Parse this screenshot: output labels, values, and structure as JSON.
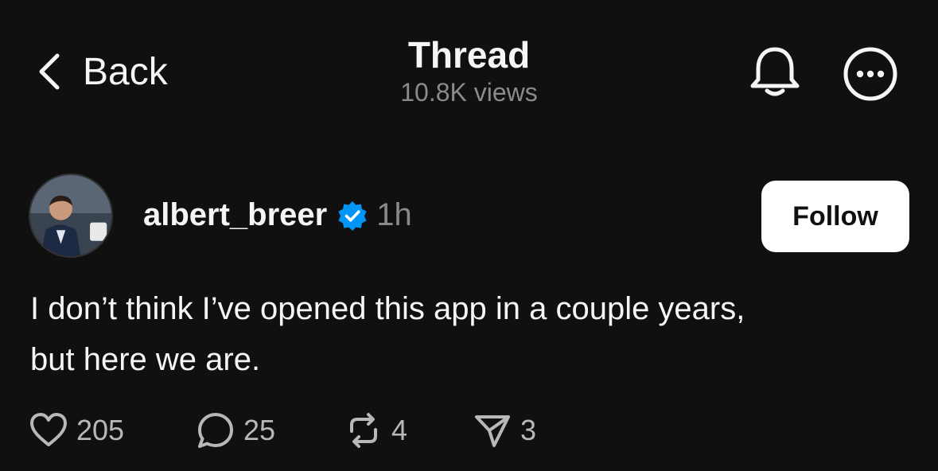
{
  "header": {
    "back_label": "Back",
    "title": "Thread",
    "views": "10.8K views",
    "icons": [
      "chevron-left-icon",
      "bell-icon",
      "more-icon"
    ]
  },
  "post": {
    "username": "albert_breer",
    "verified": true,
    "time": "1h",
    "follow_label": "Follow",
    "text_line1": "I don’t think I’ve opened this app in a couple years,",
    "text_line2": "but here we are.",
    "likes": "205",
    "replies": "25",
    "reposts": "4",
    "shares": "3"
  },
  "colors": {
    "background": "#101010",
    "text": "#f3f5f7",
    "muted": "#8a8a8a",
    "verified": "#0095f6",
    "follow_bg": "#ffffff"
  }
}
